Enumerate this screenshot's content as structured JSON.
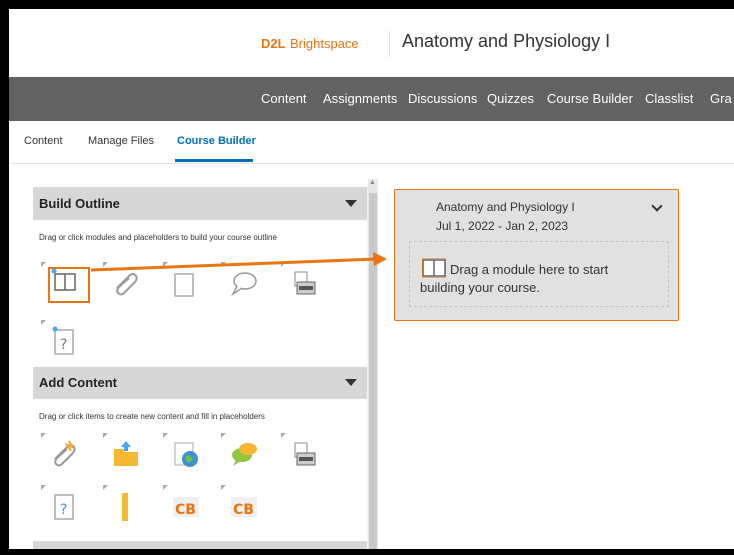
{
  "header": {
    "brand_d2l": "D2L",
    "brand_name": "Brightspace",
    "course_title": "Anatomy and Physiology I"
  },
  "navbar": {
    "items": [
      "Content",
      "Assignments",
      "Discussions",
      "Quizzes",
      "Course Builder",
      "Classlist",
      "Gra"
    ]
  },
  "subtabs": {
    "items": [
      "Content",
      "Manage Files",
      "Course Builder"
    ],
    "active": "Course Builder"
  },
  "build_outline": {
    "title": "Build Outline",
    "hint": "Drag or click modules and placeholders to build your course outline",
    "icons": [
      "module-book-icon",
      "attachment-icon",
      "blank-page-icon",
      "discussion-icon",
      "dropbox-icon",
      "quiz-icon"
    ]
  },
  "add_content": {
    "title": "Add Content",
    "hint": "Drag or click items to create new content and fill in placeholders",
    "icons": [
      "attachment-new-icon",
      "folder-upload-icon",
      "web-link-icon",
      "discussion-new-icon",
      "dropbox-new-icon",
      "quiz-new-icon",
      "survey-ruler-icon",
      "cb-icon",
      "cb-icon"
    ],
    "cb_label": "CB"
  },
  "course_card": {
    "title": "Anatomy and Physiology I",
    "dates": "Jul 1, 2022 - Jan 2, 2023",
    "drop_line1": "Drag a module here to start",
    "drop_line2": "building your course."
  },
  "colors": {
    "accent": "#e87511",
    "nav_bg": "#626262",
    "link": "#006fbf"
  }
}
